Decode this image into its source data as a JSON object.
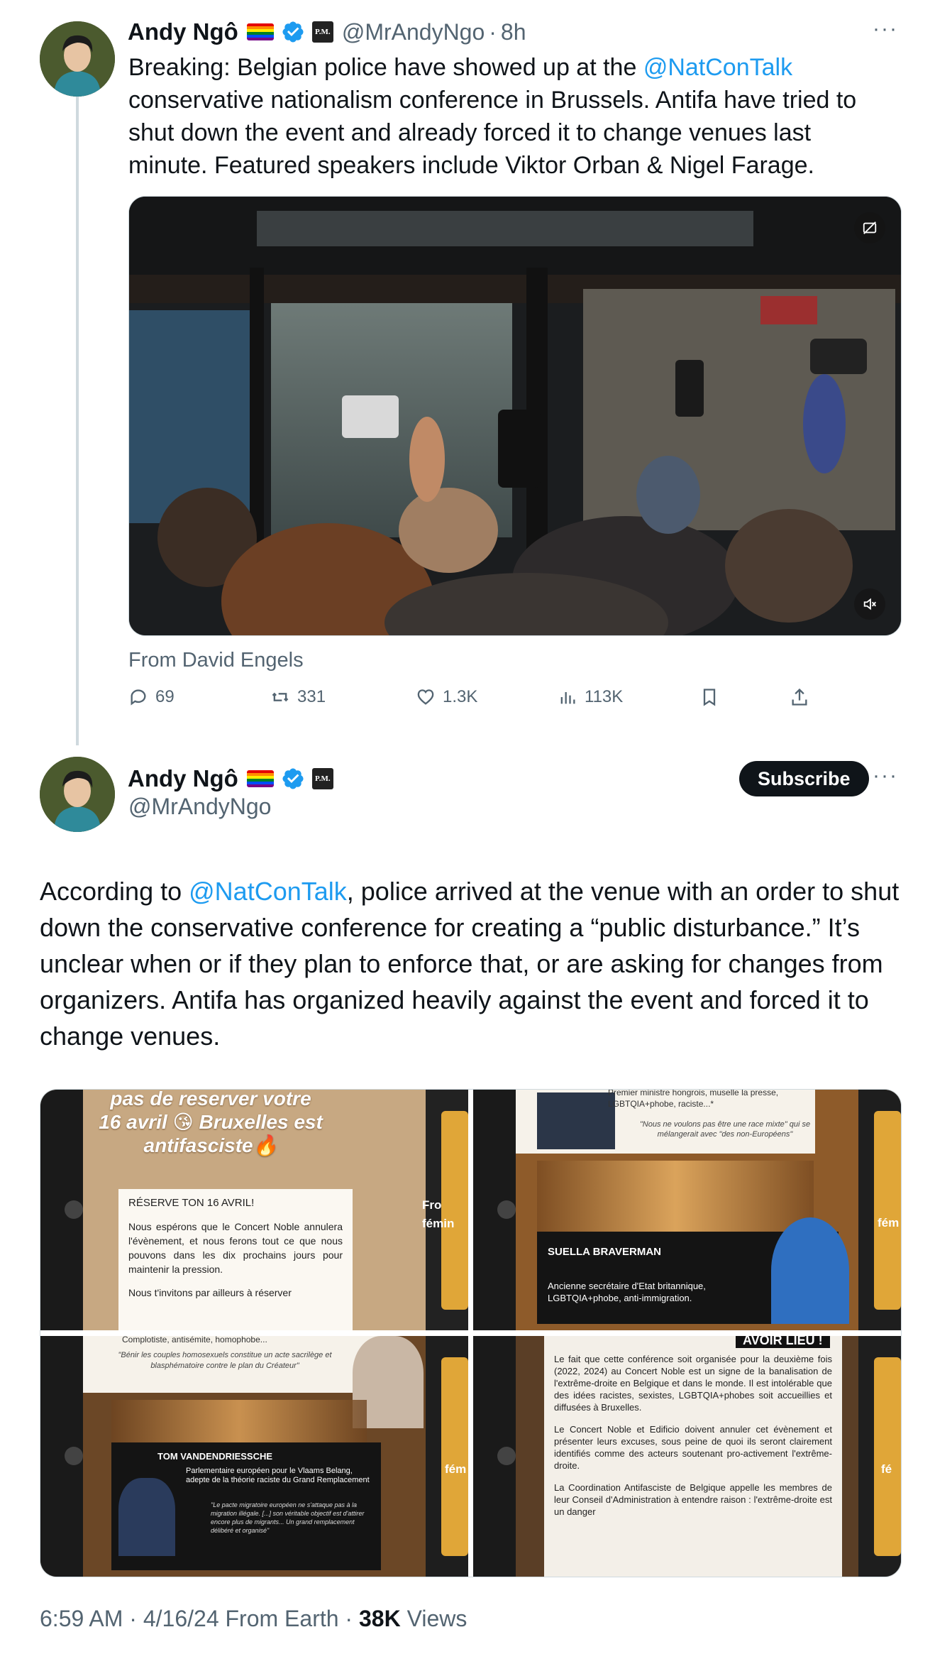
{
  "tweet1": {
    "author_name": "Andy Ngô",
    "handle": "@MrAndyNgo",
    "separator": "·",
    "time": "8h",
    "text_before": "Breaking: Belgian police have showed up at the ",
    "mention": "@NatConTalk",
    "text_after": " conservative nationalism conference in Brussels. Antifa have tried to shut down the event and already forced it to change venues last minute. Featured speakers include Viktor Orban & Nigel Farage.",
    "media_source": "From David Engels",
    "stats": {
      "replies": "69",
      "reposts": "331",
      "likes": "1.3K",
      "views": "113K"
    },
    "more_label": "···",
    "pm_badge": "P.M."
  },
  "tweet2": {
    "author_name": "Andy Ngô",
    "handle": "@MrAndyNgo",
    "subscribe_label": "Subscribe",
    "more_label": "···",
    "pm_badge": "P.M.",
    "text_before": "According to ",
    "mention": "@NatConTalk",
    "text_after": ", police arrived at the venue with an order to shut down the conservative conference for creating a “public disturbance.” It’s unclear when or if they plan to enforce that, or are asking for changes from organizers. Antifa has organized heavily against the event and forced it to change venues.",
    "images": {
      "img1": {
        "banner": "pas de reserver votre 16 avril 😘 Bruxelles est antifasciste🔥",
        "card_title": "RÉSERVE TON 16 AVRIL!",
        "card_text": "Nous espérons que le Concert Noble annulera l'évènement, et nous ferons tout ce que nous pouvons dans les dix prochains jours pour maintenir la pression.",
        "card_text2": "Nous t'invitons par ailleurs à réserver",
        "side_text": "Fro fémin"
      },
      "img2": {
        "top_text": "Premier ministre hongrois, muselle la presse, LGBTQIA+phobe, raciste...*",
        "quote": "\"Nous ne voulons pas être une race mixte\" qui se mélangerait avec \"des non-Européens\"",
        "name": "SUELLA BRAVERMAN",
        "desc": "Ancienne secrétaire d'Etat britannique, LGBTQIA+phobe, anti-immigration.",
        "side_text": "fém"
      },
      "img3": {
        "top_text": "Complotiste, antisémite, homophobe...",
        "quote": "\"Bénir les couples homosexuels constitue un acte sacrilège et blasphématoire contre le plan du Créateur\"",
        "name": "TOM VANDENDRIESSCHE",
        "desc": "Parlementaire européen pour le Vlaams Belang, adepte de la théorie raciste du Grand Remplacement",
        "quote2": "\"Le pacte migratoire européen ne s'attaque pas à la migration illégale. [...] son véritable objectif est d'attirer encore plus de migrants... Un grand remplacement délibéré et organisé\"",
        "side_text": "fém"
      },
      "img4": {
        "header": "AVOIR LIEU !",
        "para1": "Le fait que cette conférence soit organisée pour la deuxième fois (2022, 2024) au Concert Noble est un signe de la banalisation de l'extrême-droite en Belgique et dans le monde. Il est intolérable que des idées racistes, sexistes, LGBTQIA+phobes soit accueillies et diffusées à Bruxelles.",
        "para2": "Le Concert Noble et Edificio doivent annuler cet évènement et présenter leurs excuses, sous peine de quoi ils seront clairement identifiés comme des acteurs soutenant pro-activement l'extrême-droite.",
        "para3": "La Coordination Antifasciste de Belgique appelle les membres de leur Conseil d'Administration à entendre raison : l'extrême-droite est un danger",
        "side_text": "fé"
      }
    },
    "footer": {
      "time": "6:59 AM",
      "sep1": " · ",
      "date": "4/16/24",
      "source": " From Earth",
      "sep2": " · ",
      "views_count": "38K",
      "views_label": " Views"
    }
  },
  "colors": {
    "accent": "#1d9bf0",
    "text": "#0f1419",
    "muted": "#536471",
    "line": "#cfd9de"
  }
}
